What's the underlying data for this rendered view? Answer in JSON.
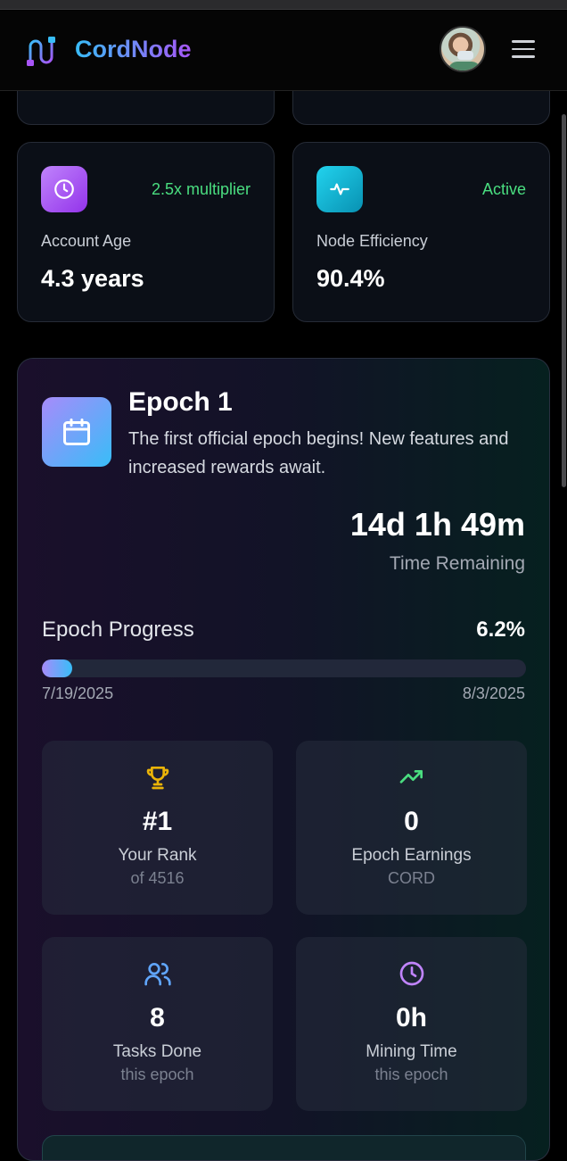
{
  "header": {
    "brand": "CordNode",
    "logo_icon": "cable-plug-icon",
    "avatar": "user-avatar",
    "menu_icon": "hamburger-menu-icon"
  },
  "stats": [
    {
      "icon": "clock-icon",
      "tag": "2.5x multiplier",
      "label": "Account Age",
      "value": "4.3 years",
      "icon_bg": "#a855f7"
    },
    {
      "icon": "activity-icon",
      "tag": "Active",
      "label": "Node Efficiency",
      "value": "90.4%",
      "icon_bg": "#06b6d4"
    }
  ],
  "epoch": {
    "title": "Epoch 1",
    "description": "The first official epoch begins! New features and increased rewards await.",
    "icon": "calendar-icon",
    "countdown": "14d 1h 49m",
    "countdown_label": "Time Remaining",
    "progress_label": "Epoch Progress",
    "progress_text": "6.2%",
    "progress_value": 0.062,
    "start_date": "7/19/2025",
    "end_date": "8/3/2025",
    "cards": [
      {
        "icon": "trophy-icon",
        "value": "#1",
        "label": "Your Rank",
        "sub": "of 4516",
        "color": "#eab308"
      },
      {
        "icon": "trending-up-icon",
        "value": "0",
        "label": "Epoch Earnings",
        "sub": "CORD",
        "color": "#4ade80"
      },
      {
        "icon": "users-icon",
        "value": "8",
        "label": "Tasks Done",
        "sub": "this epoch",
        "color": "#60a5fa"
      },
      {
        "icon": "clock-icon",
        "value": "0h",
        "label": "Mining Time",
        "sub": "this epoch",
        "color": "#c084fc"
      }
    ]
  },
  "colors": {
    "accent_green": "#4ade80",
    "gradient_start": "#a78bfa",
    "gradient_end": "#38bdf8"
  }
}
